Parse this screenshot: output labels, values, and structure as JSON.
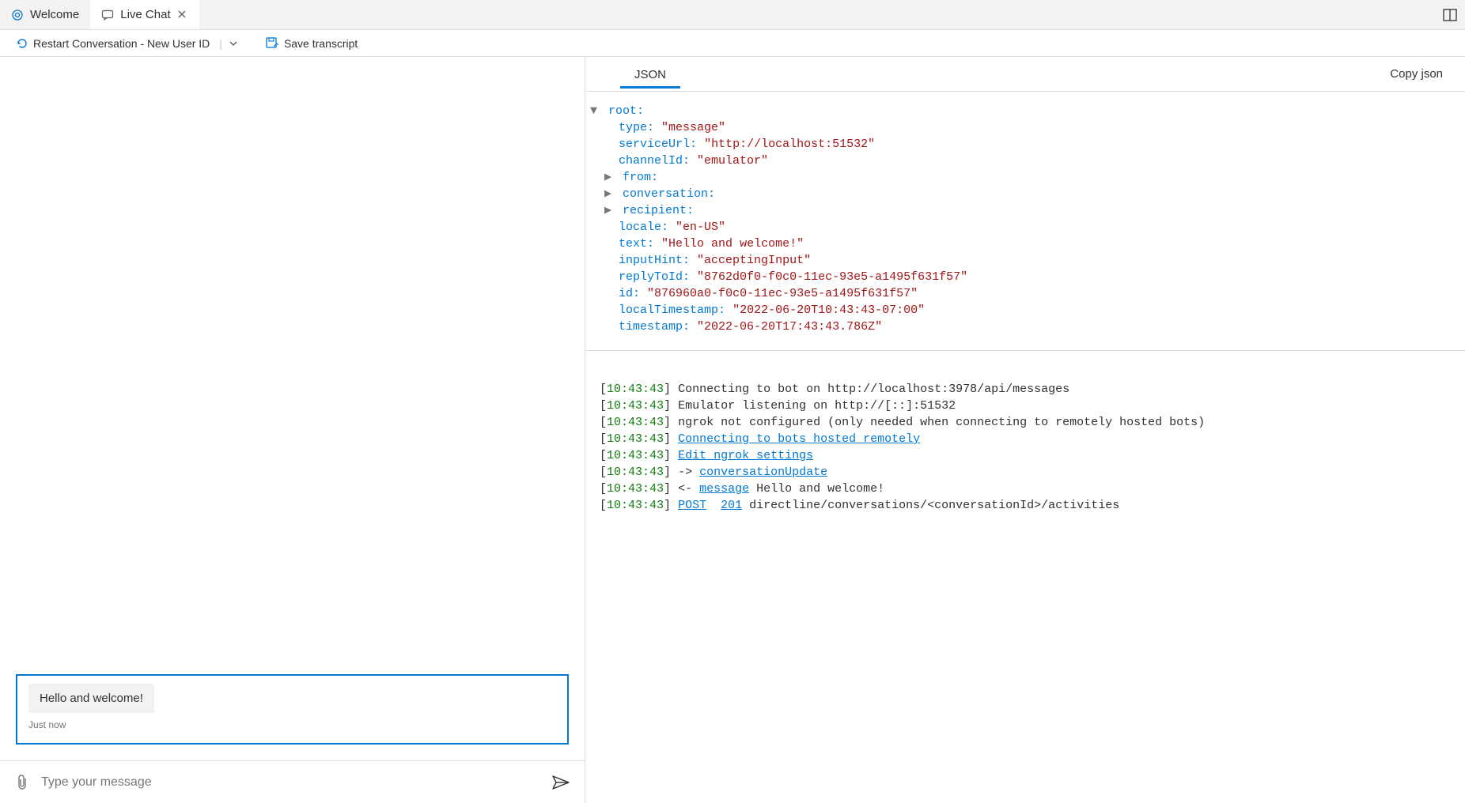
{
  "tabs": {
    "welcome": "Welcome",
    "livechat": "Live Chat"
  },
  "toolbar": {
    "restart": "Restart Conversation - New User ID",
    "save": "Save transcript"
  },
  "chat": {
    "bubble": "Hello and welcome!",
    "timestamp": "Just now",
    "placeholder": "Type your message"
  },
  "inspector": {
    "tab": "JSON",
    "copy": "Copy json"
  },
  "json": {
    "root": "root:",
    "type_k": "type:",
    "type_v": "\"message\"",
    "serviceUrl_k": "serviceUrl:",
    "serviceUrl_v": "\"http://localhost:51532\"",
    "channelId_k": "channelId:",
    "channelId_v": "\"emulator\"",
    "from_k": "from:",
    "conversation_k": "conversation:",
    "recipient_k": "recipient:",
    "locale_k": "locale:",
    "locale_v": "\"en-US\"",
    "text_k": "text:",
    "text_v": "\"Hello and welcome!\"",
    "inputHint_k": "inputHint:",
    "inputHint_v": "\"acceptingInput\"",
    "replyToId_k": "replyToId:",
    "replyToId_v": "\"8762d0f0-f0c0-11ec-93e5-a1495f631f57\"",
    "id_k": "id:",
    "id_v": "\"876960a0-f0c0-11ec-93e5-a1495f631f57\"",
    "localTimestamp_k": "localTimestamp:",
    "localTimestamp_v": "\"2022-06-20T10:43:43-07:00\"",
    "timestamp_k": "timestamp:",
    "timestamp_v": "\"2022-06-20T17:43:43.786Z\""
  },
  "log": {
    "t": "10:43:43",
    "l1": "Connecting to bot on http://localhost:3978/api/messages",
    "l2": "Emulator listening on http://[::]:51532",
    "l3": "ngrok not configured (only needed when connecting to remotely hosted bots)",
    "l4_link": "Connecting to bots hosted remotely",
    "l5_link": "Edit ngrok settings",
    "l6_arrow": "->",
    "l6_link": "conversationUpdate",
    "l7_arrow": "<-",
    "l7_link": "message",
    "l7_text": "Hello and welcome!",
    "l8_post": "POST",
    "l8_code": "201",
    "l8_text": "directline/conversations/<conversationId>/activities"
  }
}
